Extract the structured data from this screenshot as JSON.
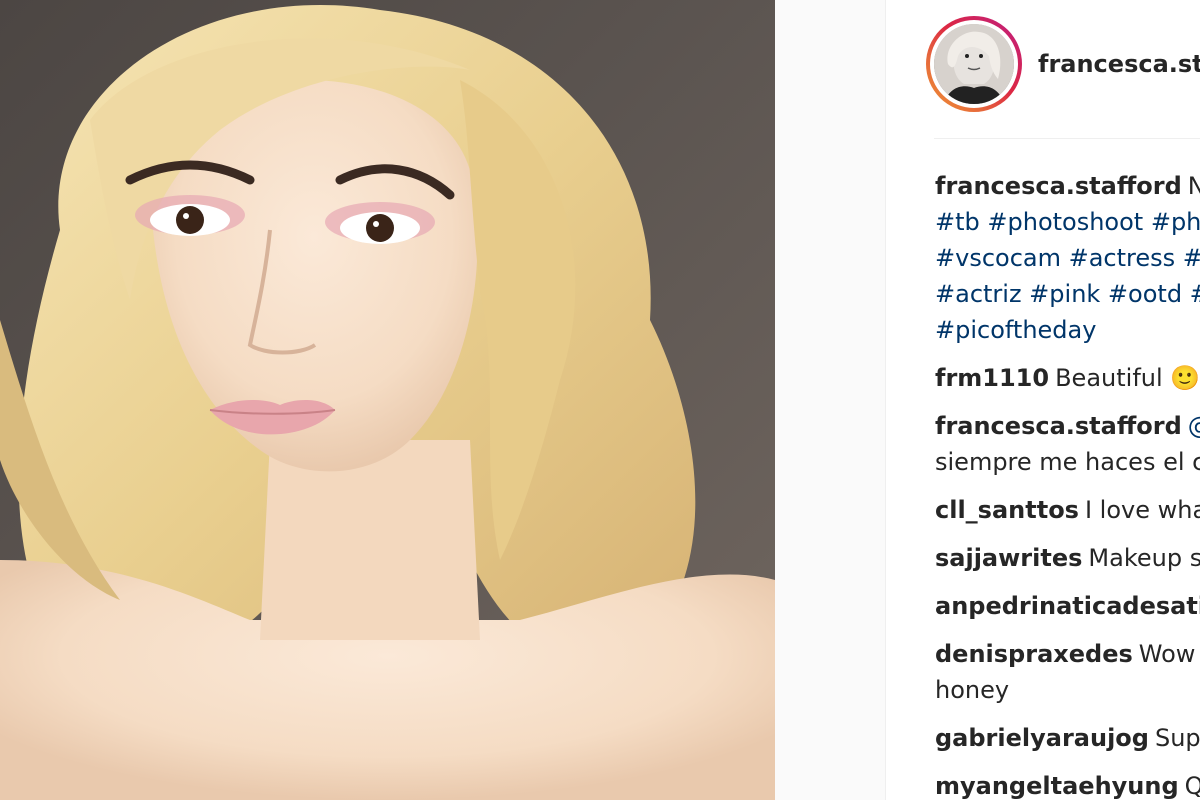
{
  "post": {
    "username": "francesca.sta",
    "photo_alt": "portrait-photo"
  },
  "caption": {
    "user": "francesca.stafford",
    "text_start": "Ne",
    "hashtags_line1": "#tb #photoshoot #ph",
    "hashtags_line2": "#vscocam #actress #i",
    "hashtags_line3": "#actriz #pink #ootd #",
    "hashtags_line4": "#picoftheday"
  },
  "comments": [
    {
      "user": "frm1110",
      "text": "Beautiful 🙂"
    },
    {
      "user": "francesca.stafford",
      "text": "@c",
      "text2": "siempre me haces el c"
    },
    {
      "user": "cll_santtos",
      "text": "I love wha"
    },
    {
      "user": "sajjawrites",
      "text": "Makeup so"
    },
    {
      "user": "anpedrinaticadesative",
      "text": ""
    },
    {
      "user": "denispraxedes",
      "text": "Wow w",
      "text2": "honey"
    },
    {
      "user": "gabrielyaraujog",
      "text": "Supe"
    },
    {
      "user": "myangeltaehyung",
      "text": "Qu"
    }
  ]
}
